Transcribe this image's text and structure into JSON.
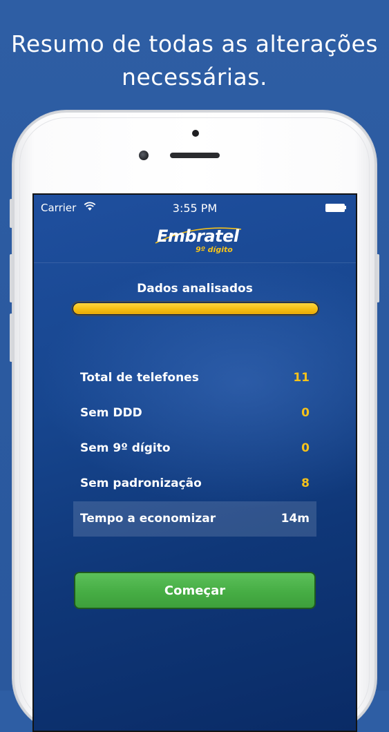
{
  "headline": {
    "line1": "Resumo de todas as alterações",
    "line2": "necessárias."
  },
  "status_bar": {
    "carrier": "Carrier",
    "time": "3:55 PM",
    "wifi_icon": "wifi-icon",
    "battery_icon": "battery-icon"
  },
  "logo": {
    "main": "Embratel",
    "sub": "9º dígito"
  },
  "progress": {
    "title": "Dados analisados",
    "value": 1.0
  },
  "stats": [
    {
      "label": "Total de telefones",
      "value": "11"
    },
    {
      "label": "Sem DDD",
      "value": "0"
    },
    {
      "label": "Sem 9º dígito",
      "value": "0"
    },
    {
      "label": "Sem padronização",
      "value": "8"
    },
    {
      "label": "Tempo a economizar",
      "value": "14m"
    }
  ],
  "start_button": {
    "label": "Começar"
  },
  "colors": {
    "background": "#2e5ea4",
    "accent_yellow": "#f6c21a",
    "button_green": "#46ad44"
  }
}
